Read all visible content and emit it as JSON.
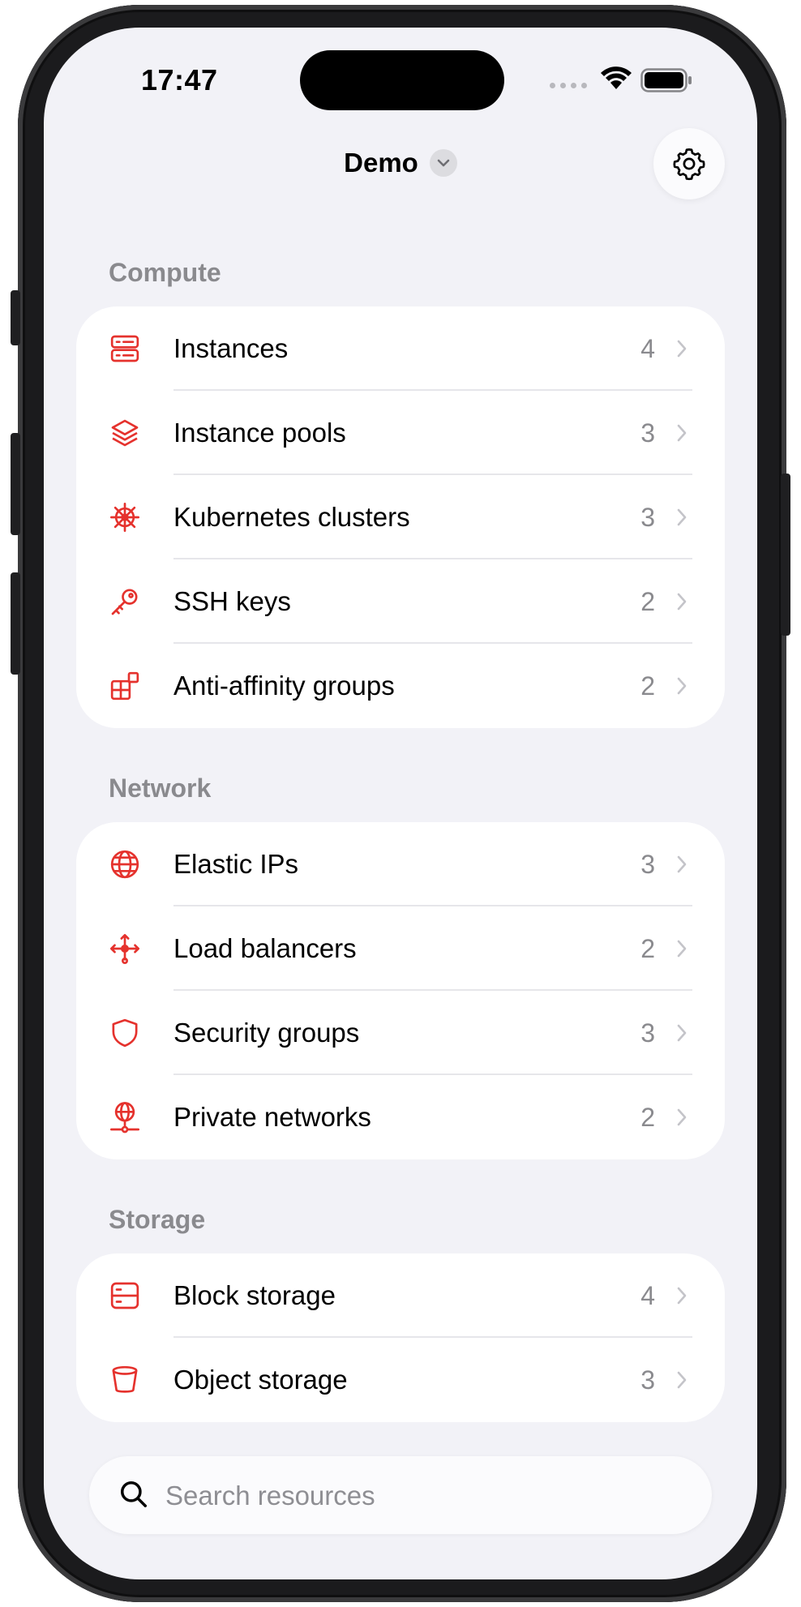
{
  "status_bar": {
    "time": "17:47"
  },
  "header": {
    "title": "Demo"
  },
  "colors": {
    "accent": "#e5322d",
    "background": "#f2f2f7",
    "secondary_text": "#8a8a8e"
  },
  "sections": [
    {
      "label": "Compute",
      "items": [
        {
          "label": "Instances",
          "count": "4",
          "icon": "server-icon"
        },
        {
          "label": "Instance pools",
          "count": "3",
          "icon": "layers-icon"
        },
        {
          "label": "Kubernetes clusters",
          "count": "3",
          "icon": "helm-icon"
        },
        {
          "label": "SSH keys",
          "count": "2",
          "icon": "key-icon"
        },
        {
          "label": "Anti-affinity groups",
          "count": "2",
          "icon": "blocks-icon"
        }
      ]
    },
    {
      "label": "Network",
      "items": [
        {
          "label": "Elastic IPs",
          "count": "3",
          "icon": "globe-icon"
        },
        {
          "label": "Load balancers",
          "count": "2",
          "icon": "split-arrows-icon"
        },
        {
          "label": "Security groups",
          "count": "3",
          "icon": "shield-icon"
        },
        {
          "label": "Private networks",
          "count": "2",
          "icon": "network-globe-icon"
        }
      ]
    },
    {
      "label": "Storage",
      "items": [
        {
          "label": "Block storage",
          "count": "4",
          "icon": "block-storage-icon"
        },
        {
          "label": "Object storage",
          "count": "3",
          "icon": "bucket-icon"
        }
      ]
    }
  ],
  "search": {
    "placeholder": "Search resources",
    "value": ""
  }
}
